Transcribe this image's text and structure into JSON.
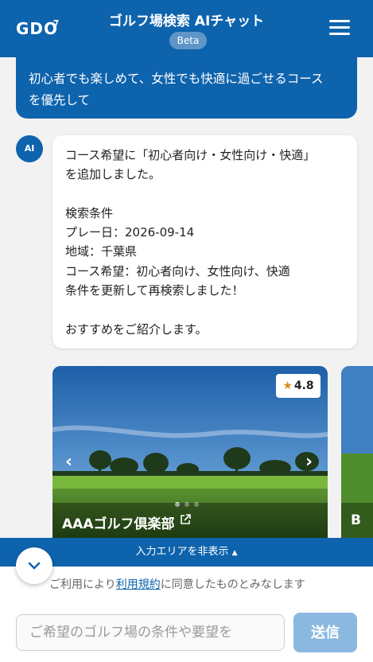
{
  "header": {
    "logo_text": "GDO",
    "title": "ゴルフ場検索 AIチャット",
    "badge": "Beta"
  },
  "user_message": {
    "lines": [
      "初心者でも楽しめて、女性でも快適に過ごせるコース",
      "を優先して"
    ]
  },
  "ai_message": {
    "avatar_label": "AI",
    "lines": [
      "コース希望に「初心者向け・女性向け・快適」",
      "を追加しました。",
      "",
      "検索条件",
      "プレー日：2026-09-14",
      "地域：千葉県",
      "コース希望：初心者向け、女性向け、快適",
      "条件を更新して再検索しました！",
      "",
      "おすすめをご紹介します。"
    ]
  },
  "cards": [
    {
      "name": "AAAゴルフ倶楽部",
      "rating": "4.8",
      "image_count": 3,
      "current_image": 1
    },
    {
      "name": "B"
    }
  ],
  "bottom": {
    "toggle_label": "入力エリアを非表示",
    "terms_prefix": "ご利用により",
    "terms_link": "利用規約",
    "terms_suffix": "に同意したものとみなします",
    "input_placeholder": "ご希望のゴルフ場の条件や要望を",
    "send_label": "送信"
  },
  "colors": {
    "brand": "#0e63ad",
    "send_disabled": "#8ab8df",
    "star": "#e08a1e"
  }
}
